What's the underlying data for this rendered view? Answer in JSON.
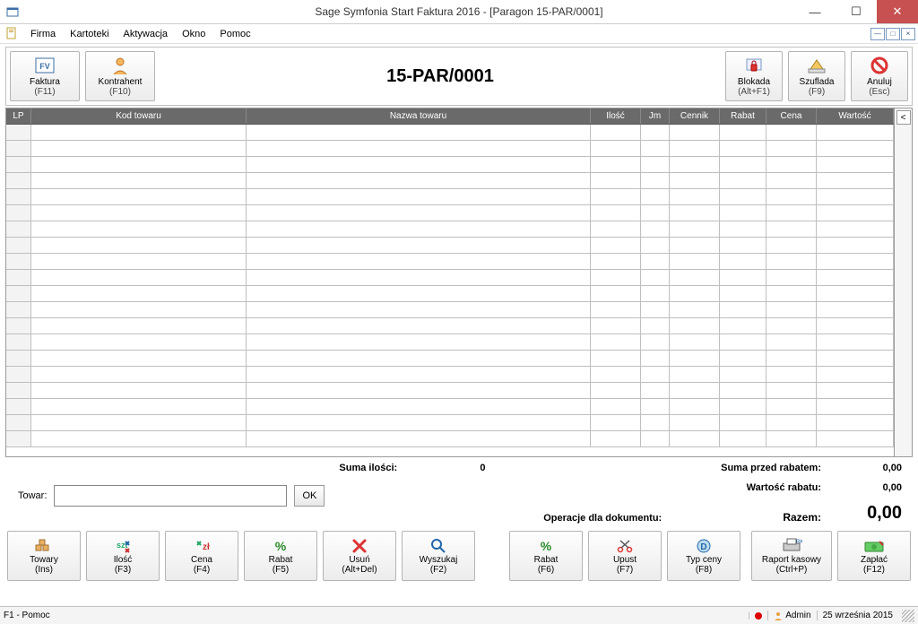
{
  "window": {
    "title": "Sage Symfonia Start Faktura 2016 - [Paragon 15-PAR/0001]"
  },
  "menu": {
    "items": [
      "Firma",
      "Kartoteki",
      "Aktywacja",
      "Okno",
      "Pomoc"
    ]
  },
  "toolbar": {
    "faktura_label": "Faktura",
    "faktura_sc": "(F11)",
    "kontrahent_label": "Kontrahent",
    "kontrahent_sc": "(F10)",
    "blokada_label": "Blokada",
    "blokada_sc": "(Alt+F1)",
    "szuflada_label": "Szuflada",
    "szuflada_sc": "(F9)",
    "anuluj_label": "Anuluj",
    "anuluj_sc": "(Esc)",
    "doc_title": "15-PAR/0001"
  },
  "grid": {
    "headers": {
      "lp": "LP",
      "kod": "Kod towaru",
      "nazwa": "Nazwa towaru",
      "ilosc": "Ilość",
      "jm": "Jm",
      "cennik": "Cennik",
      "rabat": "Rabat",
      "cena": "Cena",
      "wartosc": "Wartość"
    }
  },
  "summary": {
    "suma_ilosci_label": "Suma ilości:",
    "suma_ilosci_value": "0",
    "suma_przed_rabatem_label": "Suma przed rabatem:",
    "suma_przed_rabatem_value": "0,00",
    "wartosc_rabatu_label": "Wartość rabatu:",
    "wartosc_rabatu_value": "0,00",
    "razem_label": "Razem:",
    "razem_value": "0,00",
    "operacje_label": "Operacje dla dokumentu:"
  },
  "towar": {
    "label": "Towar:",
    "value": "",
    "placeholder": "",
    "ok": "OK"
  },
  "bottom": {
    "towary": {
      "label": "Towary",
      "sc": "(Ins)"
    },
    "ilosc": {
      "label": "Ilość",
      "sc": "(F3)"
    },
    "cena": {
      "label": "Cena",
      "sc": "(F4)"
    },
    "rabat": {
      "label": "Rabat",
      "sc": "(F5)"
    },
    "usun": {
      "label": "Usuń",
      "sc": "(Alt+Del)"
    },
    "wyszukaj": {
      "label": "Wyszukaj",
      "sc": "(F2)"
    },
    "doc_rabat": {
      "label": "Rabat",
      "sc": "(F6)"
    },
    "doc_upust": {
      "label": "Upust",
      "sc": "(F7)"
    },
    "doc_typceny": {
      "label": "Typ ceny",
      "sc": "(F8)"
    },
    "raport": {
      "label": "Raport kasowy",
      "sc": "(Ctrl+P)"
    },
    "zaplac": {
      "label": "Zapłać",
      "sc": "(F12)"
    }
  },
  "status": {
    "help": "F1 - Pomoc",
    "user": "Admin",
    "date": "25 września 2015"
  }
}
